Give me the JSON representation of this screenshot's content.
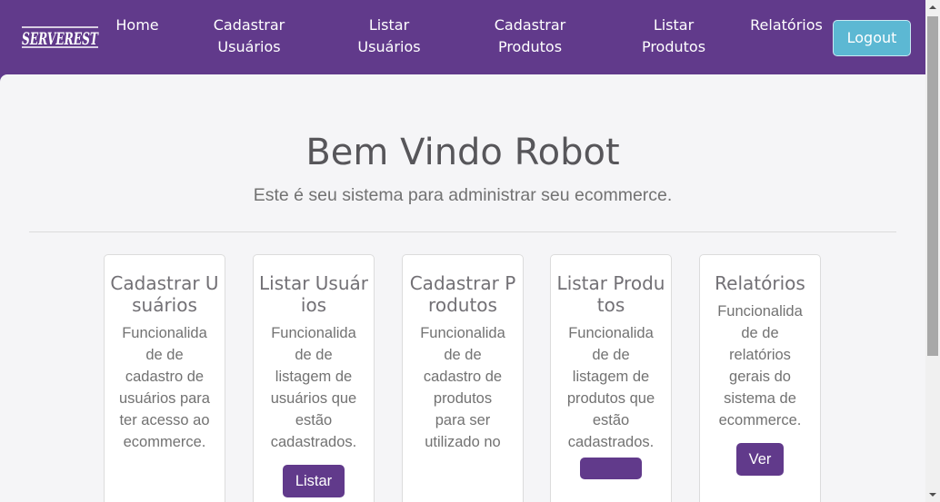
{
  "navbar": {
    "logo_text": "SERVEREST",
    "links": [
      {
        "label": "Home"
      },
      {
        "label": "Cadastrar\nUsuários"
      },
      {
        "label": "Listar\nUsuários"
      },
      {
        "label": "Cadastrar\nProdutos"
      },
      {
        "label": "Listar\nProdutos"
      },
      {
        "label": "Relatórios"
      }
    ],
    "logout_label": "Logout"
  },
  "welcome": {
    "title": "Bem Vindo Robot",
    "subtitle": "Este é seu sistema para administrar seu ecommerce."
  },
  "cards": [
    {
      "title": "Cadastrar Usuários",
      "text": "Funcionalidade de cadastro de usuários para ter acesso ao ecommerce.",
      "button": ""
    },
    {
      "title": "Listar Usuários",
      "text": "Funcionalidade de listagem de usuários que estão cadastrados.",
      "button": "Listar"
    },
    {
      "title": "Cadastrar Produtos",
      "text": "Funcionalidade de cadastro de produtos para ser utilizado no",
      "button": ""
    },
    {
      "title": "Listar Produtos",
      "text": "Funcionalidade de listagem de produtos que estão cadastrados.",
      "button": ""
    },
    {
      "title": "Relatórios",
      "text": "Funcionalidade de relatórios gerais do sistema de ecommerce.",
      "button": "Ver"
    }
  ],
  "colors": {
    "brand": "#613a8b",
    "logout": "#5cb8d3",
    "background": "#f5f5f7"
  }
}
